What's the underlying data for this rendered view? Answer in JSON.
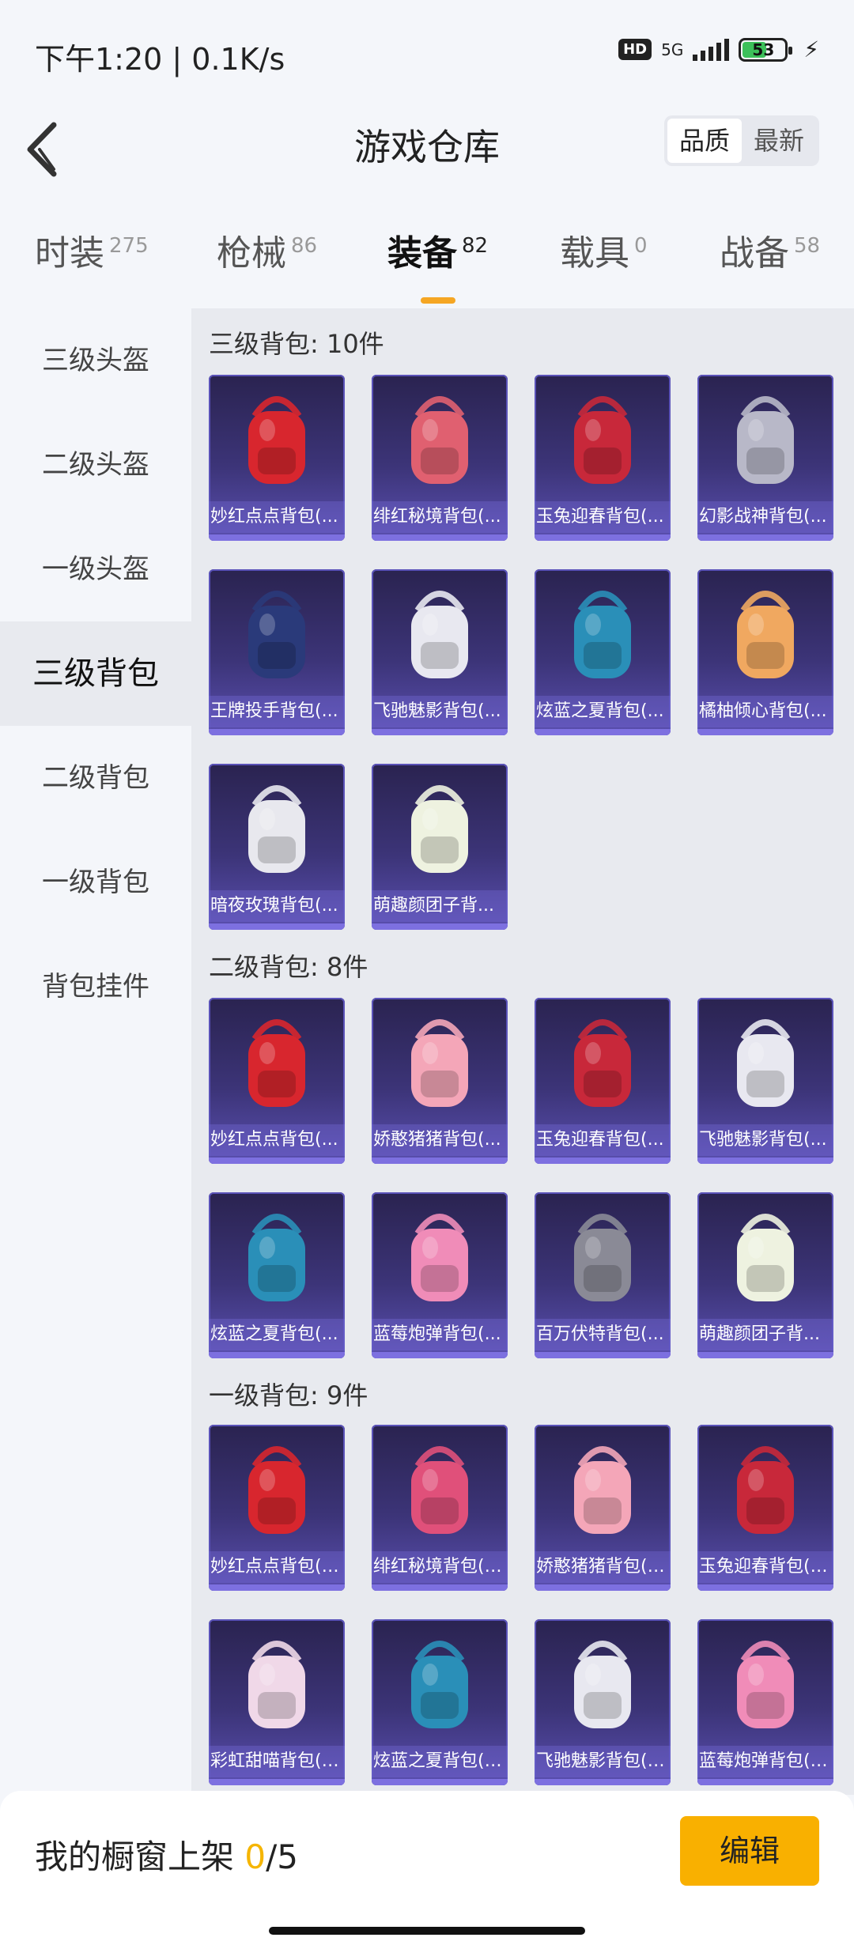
{
  "status_bar": {
    "time": "下午1:20 | 0.1K/s",
    "hd": "HD",
    "network": "5G",
    "battery": "53"
  },
  "header": {
    "title": "游戏仓库",
    "sort_quality": "品质",
    "sort_latest": "最新"
  },
  "tabs": [
    {
      "label": "时装",
      "count": "275"
    },
    {
      "label": "枪械",
      "count": "86"
    },
    {
      "label": "装备",
      "count": "82",
      "active": true
    },
    {
      "label": "载具",
      "count": "0"
    },
    {
      "label": "战备",
      "count": "58"
    }
  ],
  "sidebar": [
    {
      "label": "三级头盔"
    },
    {
      "label": "二级头盔"
    },
    {
      "label": "一级头盔"
    },
    {
      "label": "三级背包",
      "active": true
    },
    {
      "label": "二级背包"
    },
    {
      "label": "一级背包"
    },
    {
      "label": "背包挂件"
    }
  ],
  "sections": [
    {
      "title": "三级背包: 10件",
      "items": [
        {
          "name": "妙红点点背包(...",
          "color": "#d8262e",
          "icon": "backpack-icon"
        },
        {
          "name": "绯红秘境背包(...",
          "color": "#e06070",
          "icon": "backpack-icon"
        },
        {
          "name": "玉兔迎春背包(...",
          "color": "#c8283a",
          "icon": "backpack-icon"
        },
        {
          "name": "幻影战神背包(...",
          "color": "#b8b8c8",
          "icon": "backpack-icon"
        },
        {
          "name": "王牌投手背包(...",
          "color": "#2a3a7a",
          "icon": "backpack-icon"
        },
        {
          "name": "飞驰魅影背包(...",
          "color": "#e8e8f0",
          "icon": "backpack-icon"
        },
        {
          "name": "炫蓝之夏背包(...",
          "color": "#2a8fb8",
          "icon": "backpack-icon"
        },
        {
          "name": "橘柚倾心背包(...",
          "color": "#f0a860",
          "icon": "backpack-icon"
        },
        {
          "name": "暗夜玫瑰背包(...",
          "color": "#e8e8ee",
          "icon": "backpack-icon"
        },
        {
          "name": "萌趣颜团子背...",
          "color": "#eef2e0",
          "icon": "backpack-icon"
        }
      ]
    },
    {
      "title": "二级背包: 8件",
      "items": [
        {
          "name": "妙红点点背包(...",
          "color": "#d8262e",
          "icon": "backpack-icon"
        },
        {
          "name": "娇憨猪猪背包(...",
          "color": "#f4a6b8",
          "icon": "backpack-icon"
        },
        {
          "name": "玉兔迎春背包(...",
          "color": "#c8283a",
          "icon": "backpack-icon"
        },
        {
          "name": "飞驰魅影背包(...",
          "color": "#e8e8f0",
          "icon": "backpack-icon"
        },
        {
          "name": "炫蓝之夏背包(...",
          "color": "#2a8fb8",
          "icon": "backpack-icon"
        },
        {
          "name": "蓝莓炮弹背包(...",
          "color": "#f08cb8",
          "icon": "backpack-icon"
        },
        {
          "name": "百万伏特背包(...",
          "color": "#8a8a96",
          "icon": "backpack-icon"
        },
        {
          "name": "萌趣颜团子背...",
          "color": "#eef2e0",
          "icon": "backpack-icon"
        }
      ]
    },
    {
      "title": "一级背包: 9件",
      "items": [
        {
          "name": "妙红点点背包(1...",
          "color": "#d8262e",
          "icon": "backpack-icon"
        },
        {
          "name": "绯红秘境背包(1...",
          "color": "#e0507a",
          "icon": "backpack-icon"
        },
        {
          "name": "娇憨猪猪背包(1...",
          "color": "#f4a6b8",
          "icon": "backpack-icon"
        },
        {
          "name": "玉兔迎春背包(1...",
          "color": "#c8283a",
          "icon": "backpack-icon"
        },
        {
          "name": "彩虹甜喵背包(1...",
          "color": "#f0d8e8",
          "icon": "backpack-icon"
        },
        {
          "name": "炫蓝之夏背包(1...",
          "color": "#2a8fb8",
          "icon": "backpack-icon"
        },
        {
          "name": "飞驰魅影背包(1...",
          "color": "#e8e8f0",
          "icon": "backpack-icon"
        },
        {
          "name": "蓝莓炮弹背包(1...",
          "color": "#f08cb8",
          "icon": "backpack-icon"
        }
      ]
    }
  ],
  "bottom_bar": {
    "label_prefix": "我的橱窗上架 ",
    "count": "0",
    "total": "/5",
    "edit_label": "编辑"
  },
  "colors": {
    "accent": "#f5a623",
    "edit_button": "#f9b000",
    "card_bg": "#3c3478"
  }
}
